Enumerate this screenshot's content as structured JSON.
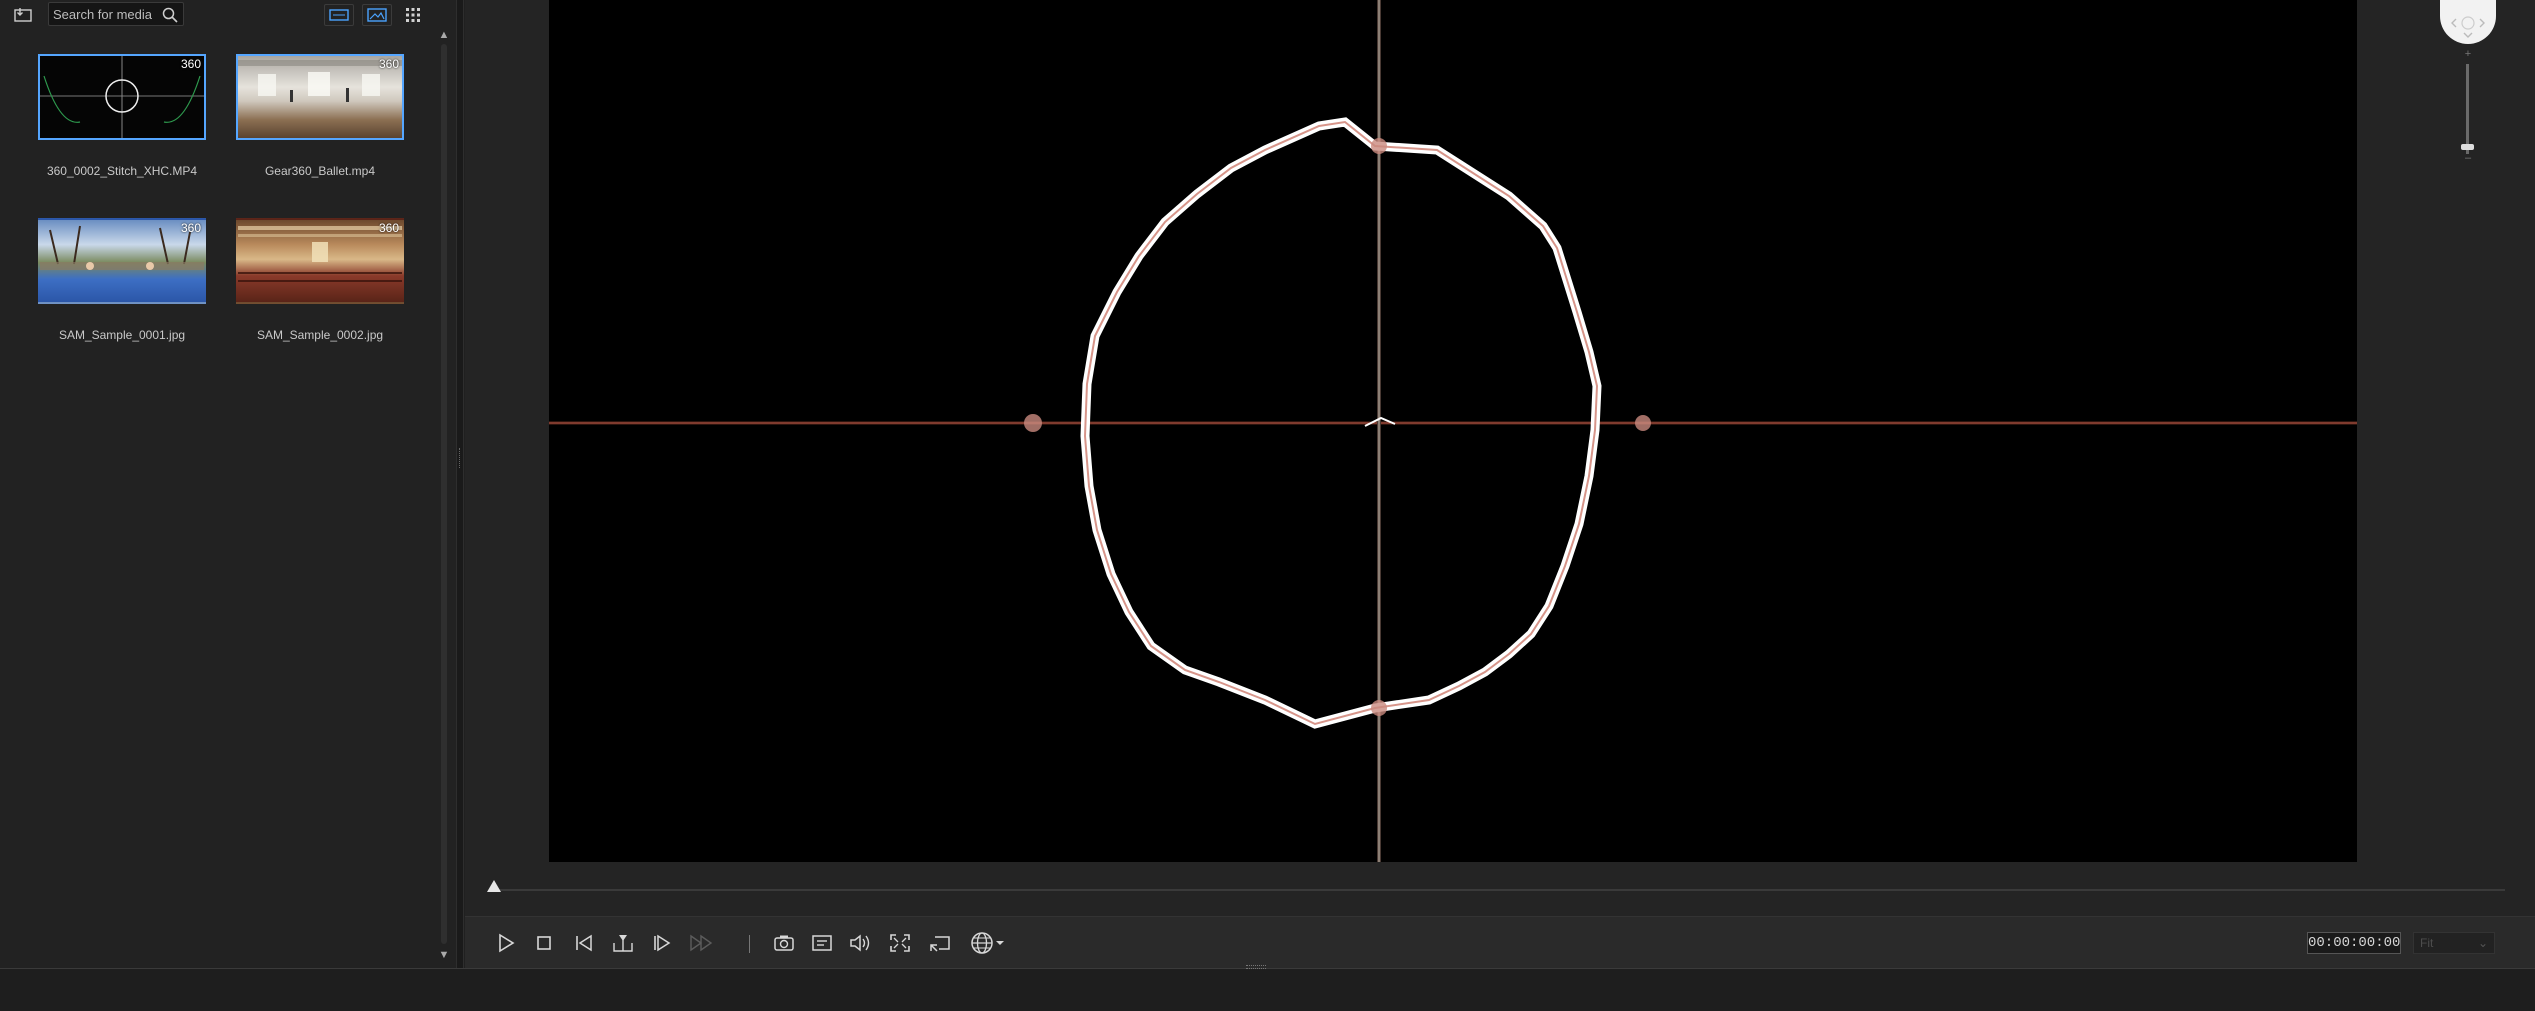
{
  "library": {
    "search": {
      "placeholder": "Search for media",
      "value": ""
    },
    "toolbar_icons": [
      "import-media-icon",
      "search-icon",
      "view-thumbnail-icon",
      "view-image-icon",
      "grid-icon"
    ],
    "media": [
      {
        "name": "360_0002_Stitch_XHC.MP4",
        "badge": "360",
        "selected": true
      },
      {
        "name": "Gear360_Ballet.mp4",
        "badge": "360",
        "selected": true
      },
      {
        "name": "SAM_Sample_0001.jpg",
        "badge": "360",
        "selected": false
      },
      {
        "name": "SAM_Sample_0002.jpg",
        "badge": "360",
        "selected": false
      }
    ]
  },
  "preview": {
    "timecode": "00:00:00:00",
    "fit_label": "Fit",
    "zoom_plus": "+",
    "zoom_minus": "–"
  },
  "colors": {
    "accent": "#55a6ff",
    "canvas": "#000000",
    "panel": "#222222"
  }
}
